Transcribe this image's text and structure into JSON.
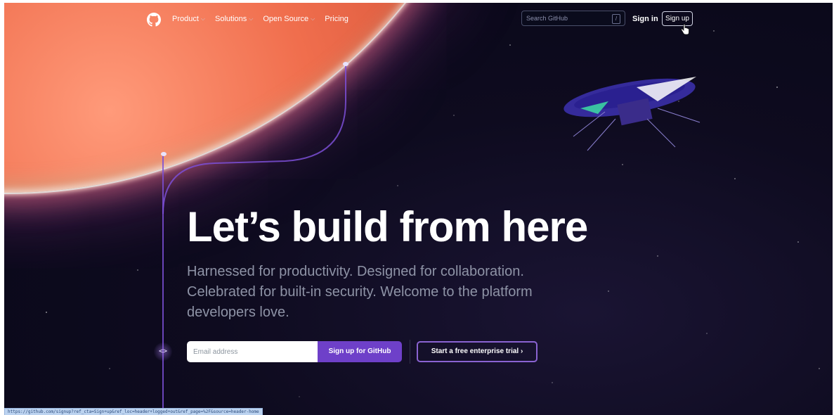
{
  "header": {
    "logo_icon": "github-mark-icon",
    "nav": [
      {
        "label": "Product",
        "has_dropdown": true
      },
      {
        "label": "Solutions",
        "has_dropdown": true
      },
      {
        "label": "Open Source",
        "has_dropdown": true
      },
      {
        "label": "Pricing",
        "has_dropdown": false
      }
    ],
    "search": {
      "placeholder": "Search GitHub",
      "shortcut": "/"
    },
    "sign_in_label": "Sign in",
    "sign_up_label": "Sign up"
  },
  "hero": {
    "title": "Let’s build from here",
    "subtitle": "Harnessed for productivity. Designed for collaboration. Celebrated for built-in security. Welcome to the platform developers love.",
    "email_placeholder": "Email address",
    "primary_cta": "Sign up for GitHub",
    "secondary_cta": "Start a free enterprise trial ›",
    "code_icon_glyph": "<>"
  },
  "status_bar": {
    "url": "https://github.com/signup?ref_cta=Sign+up&ref_loc=header+logged+out&ref_page=%2F&source=header-home"
  },
  "colors": {
    "background": "#0e0b1f",
    "accent": "#6e40c9",
    "secondary_border": "#8a63d2",
    "subtitle_text": "#8e93a6"
  }
}
